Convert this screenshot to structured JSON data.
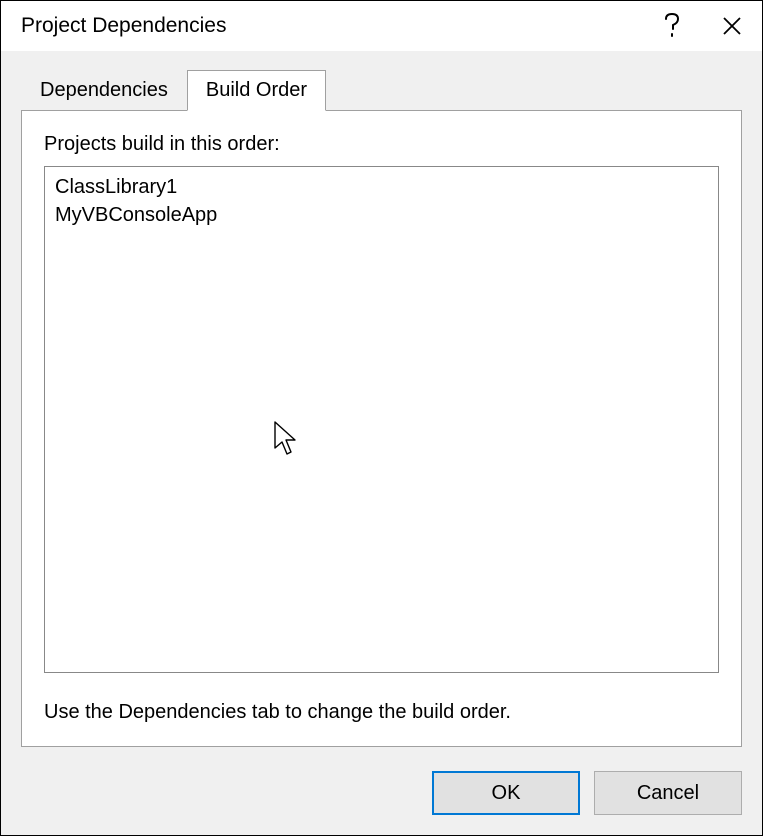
{
  "titlebar": {
    "title": "Project Dependencies"
  },
  "tabs": {
    "dependencies_label": "Dependencies",
    "build_order_label": "Build Order"
  },
  "panel": {
    "list_label": "Projects build in this order:",
    "projects": [
      "ClassLibrary1",
      "MyVBConsoleApp"
    ],
    "hint": "Use the Dependencies tab to change the build order."
  },
  "buttons": {
    "ok_label": "OK",
    "cancel_label": "Cancel"
  }
}
